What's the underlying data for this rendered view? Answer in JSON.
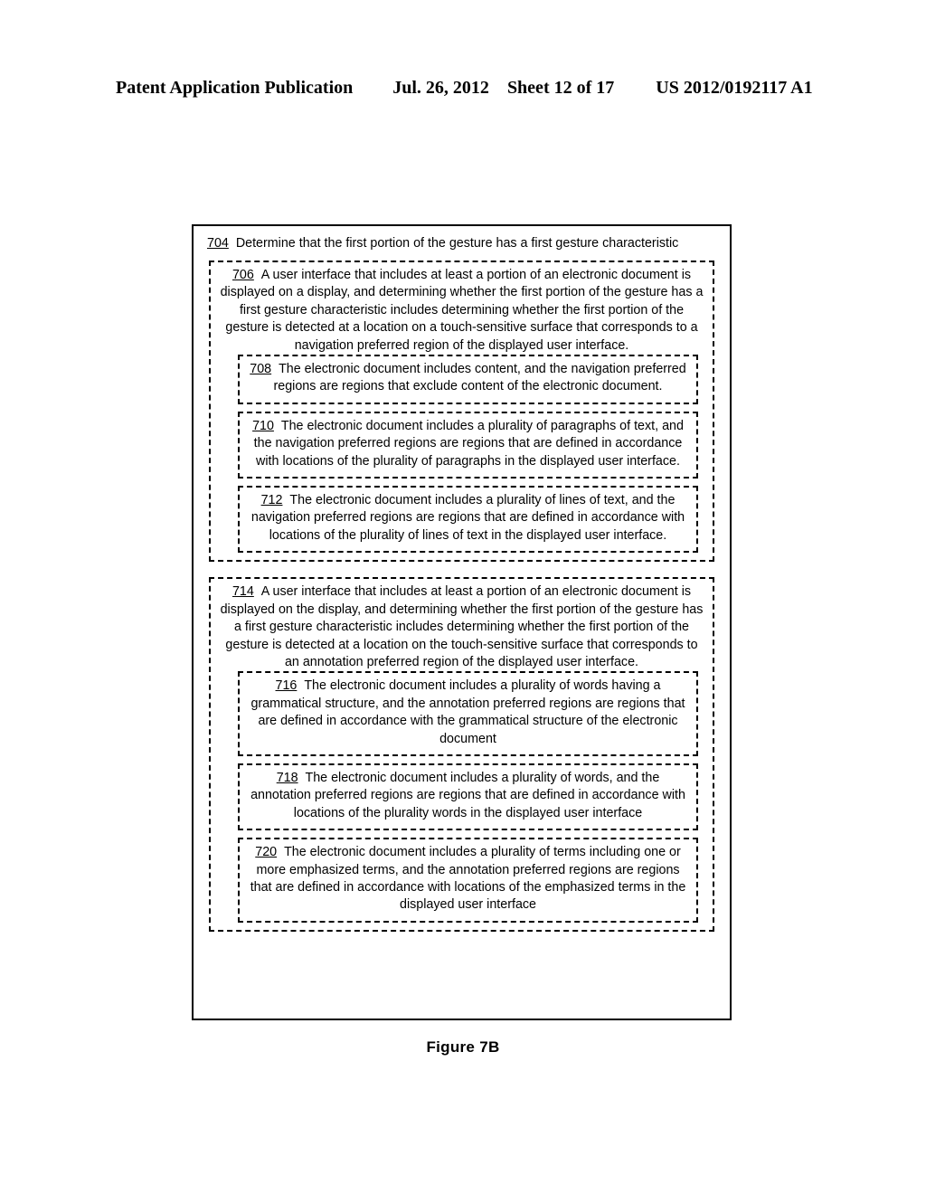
{
  "header": {
    "publication": "Patent Application Publication",
    "date": "Jul. 26, 2012",
    "sheet": "Sheet 12 of 17",
    "publication_number": "US 2012/0192117 A1"
  },
  "figure": {
    "caption": "Figure 7B"
  },
  "flowchart": {
    "step_704": {
      "ref": "704",
      "text": "Determine that the first portion of the gesture has a first gesture characteristic"
    },
    "step_706": {
      "ref": "706",
      "text": "A user interface that includes at least a portion of an electronic document is displayed on a display, and determining whether the first portion of the gesture has a first gesture characteristic includes determining whether the first portion of the gesture is detected at a location on a touch-sensitive surface that corresponds to a navigation preferred region of the displayed user interface."
    },
    "step_708": {
      "ref": "708",
      "text": "The electronic document includes content, and the navigation preferred regions are regions that exclude content of the electronic document."
    },
    "step_710": {
      "ref": "710",
      "text": "The electronic document includes a plurality of paragraphs of text, and the navigation preferred regions are regions that are defined in accordance with locations of the plurality of paragraphs in the displayed user interface."
    },
    "step_712": {
      "ref": "712",
      "text": "The electronic document includes a plurality of lines of text, and the navigation preferred regions are regions that are defined in accordance with locations of the plurality of lines of text in the displayed user interface."
    },
    "step_714": {
      "ref": "714",
      "text": "A user interface that includes at least a portion of an electronic document is displayed on the display, and determining whether the first portion of the gesture has a first gesture characteristic includes determining whether the first portion of the gesture is detected at a location on the touch-sensitive surface that corresponds to an annotation preferred region of the displayed user interface."
    },
    "step_716": {
      "ref": "716",
      "text": "The electronic document includes a plurality of words having a grammatical structure, and the annotation preferred regions are regions that are defined in accordance with the grammatical structure of the electronic document"
    },
    "step_718": {
      "ref": "718",
      "text": "The electronic document includes a plurality of words, and the annotation preferred regions are regions that are defined in accordance with locations of the plurality words in the displayed user interface"
    },
    "step_720": {
      "ref": "720",
      "text": "The electronic document includes a plurality of terms including one or more emphasized terms, and the annotation preferred regions are regions that are defined in accordance with locations of the emphasized terms in the displayed user interface"
    }
  }
}
